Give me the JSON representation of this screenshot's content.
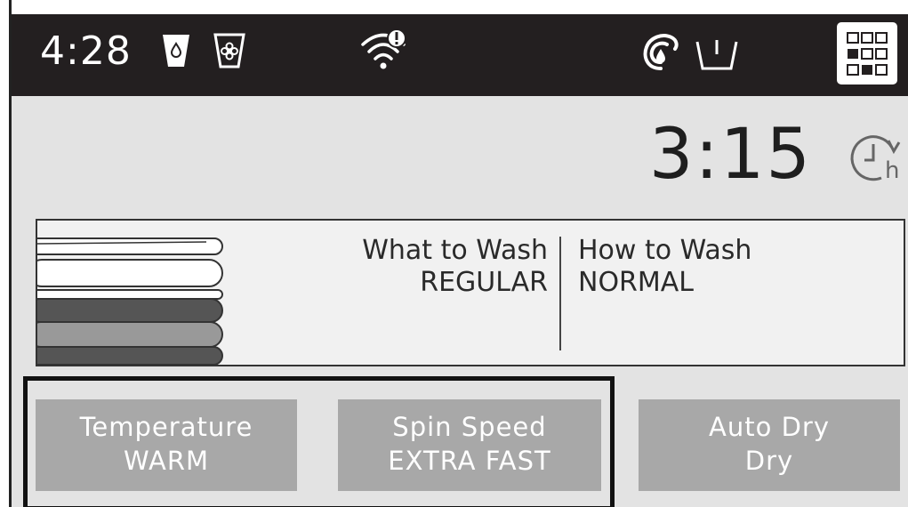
{
  "status_bar": {
    "time": "4:28",
    "icons": [
      "detergent-dispenser-icon",
      "fabric-softener-dispenser-icon",
      "wifi-alert-icon",
      "steam-icon",
      "tub-icon",
      "menu-grid-icon"
    ]
  },
  "timer": {
    "remaining": "3:15",
    "delay_icon": "delay-start-icon",
    "delay_icon_text": "h"
  },
  "cycle": {
    "icon": "clothes-stack-icon",
    "what_to_wash": {
      "label": "What to Wash",
      "value": "REGULAR"
    },
    "how_to_wash": {
      "label": "How to Wash",
      "value": "NORMAL"
    }
  },
  "options": [
    {
      "label": "Temperature",
      "value": "WARM"
    },
    {
      "label": "Spin Speed",
      "value": "EXTRA FAST"
    },
    {
      "label": "Auto Dry",
      "value": "Dry"
    }
  ],
  "colors": {
    "status_bar_bg": "#231f20",
    "screen_bg": "#e3e3e3",
    "option_button_bg": "#a8a8a8",
    "highlight_outline": "#111111"
  }
}
